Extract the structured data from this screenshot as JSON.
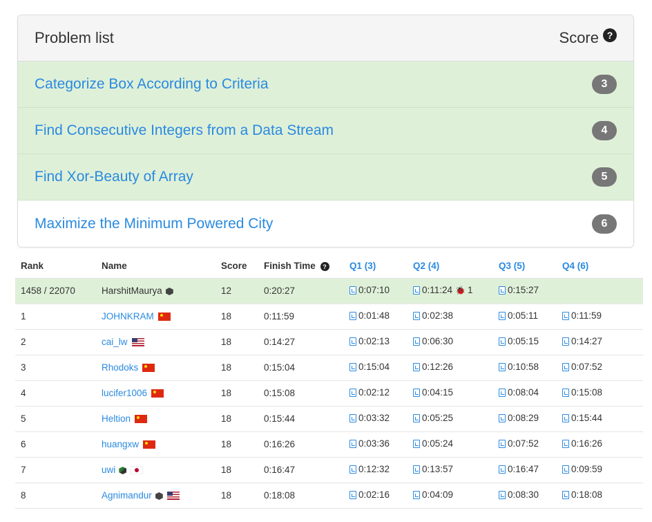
{
  "problem_panel": {
    "title": "Problem list",
    "score_label": "Score",
    "help_icon": "question-circle-icon",
    "problems": [
      {
        "name": "Categorize Box According to Criteria",
        "score": "3",
        "solved": true
      },
      {
        "name": "Find Consecutive Integers from a Data Stream",
        "score": "4",
        "solved": true
      },
      {
        "name": "Find Xor-Beauty of Array",
        "score": "5",
        "solved": true
      },
      {
        "name": "Maximize the Minimum Powered City",
        "score": "6",
        "solved": false
      }
    ]
  },
  "ranking": {
    "headers": {
      "rank": "Rank",
      "name": "Name",
      "score": "Score",
      "finish": "Finish Time",
      "q1": "Q1 (3)",
      "q2": "Q2 (4)",
      "q3": "Q3 (5)",
      "q4": "Q4 (6)"
    },
    "me": {
      "rank": "1458 / 22070",
      "name": "HarshitMaurya",
      "score": "12",
      "finish": "0:20:27",
      "q1": "0:07:10",
      "q2": "0:11:24",
      "q2_wrong": "1",
      "q3": "0:15:27",
      "q4": ""
    },
    "rows": [
      {
        "rank": "1",
        "name": "JOHNKRAM",
        "flag": "cn",
        "score": "18",
        "finish": "0:11:59",
        "q1": "0:01:48",
        "q2": "0:02:38",
        "q3": "0:05:11",
        "q4": "0:11:59"
      },
      {
        "rank": "2",
        "name": "cai_lw",
        "flag": "us",
        "score": "18",
        "finish": "0:14:27",
        "q1": "0:02:13",
        "q2": "0:06:30",
        "q3": "0:05:15",
        "q4": "0:14:27"
      },
      {
        "rank": "3",
        "name": "Rhodoks",
        "flag": "cn",
        "score": "18",
        "finish": "0:15:04",
        "q1": "0:15:04",
        "q2": "0:12:26",
        "q3": "0:10:58",
        "q4": "0:07:52"
      },
      {
        "rank": "4",
        "name": "lucifer1006",
        "flag": "cn",
        "score": "18",
        "finish": "0:15:08",
        "q1": "0:02:12",
        "q2": "0:04:15",
        "q3": "0:08:04",
        "q4": "0:15:08"
      },
      {
        "rank": "5",
        "name": "Heltion",
        "flag": "cn",
        "score": "18",
        "finish": "0:15:44",
        "q1": "0:03:32",
        "q2": "0:05:25",
        "q3": "0:08:29",
        "q4": "0:15:44"
      },
      {
        "rank": "6",
        "name": "huangxw",
        "flag": "cn",
        "score": "18",
        "finish": "0:16:26",
        "q1": "0:03:36",
        "q2": "0:05:24",
        "q3": "0:07:52",
        "q4": "0:16:26"
      },
      {
        "rank": "7",
        "name": "uwi",
        "flag": "jp",
        "score": "18",
        "finish": "0:16:47",
        "q1": "0:12:32",
        "q2": "0:13:57",
        "q3": "0:16:47",
        "q4": "0:09:59"
      },
      {
        "rank": "8",
        "name": "Agnimandur",
        "flag": "us",
        "score": "18",
        "finish": "0:18:08",
        "q1": "0:02:16",
        "q2": "0:04:09",
        "q3": "0:08:30",
        "q4": "0:18:08"
      }
    ]
  }
}
